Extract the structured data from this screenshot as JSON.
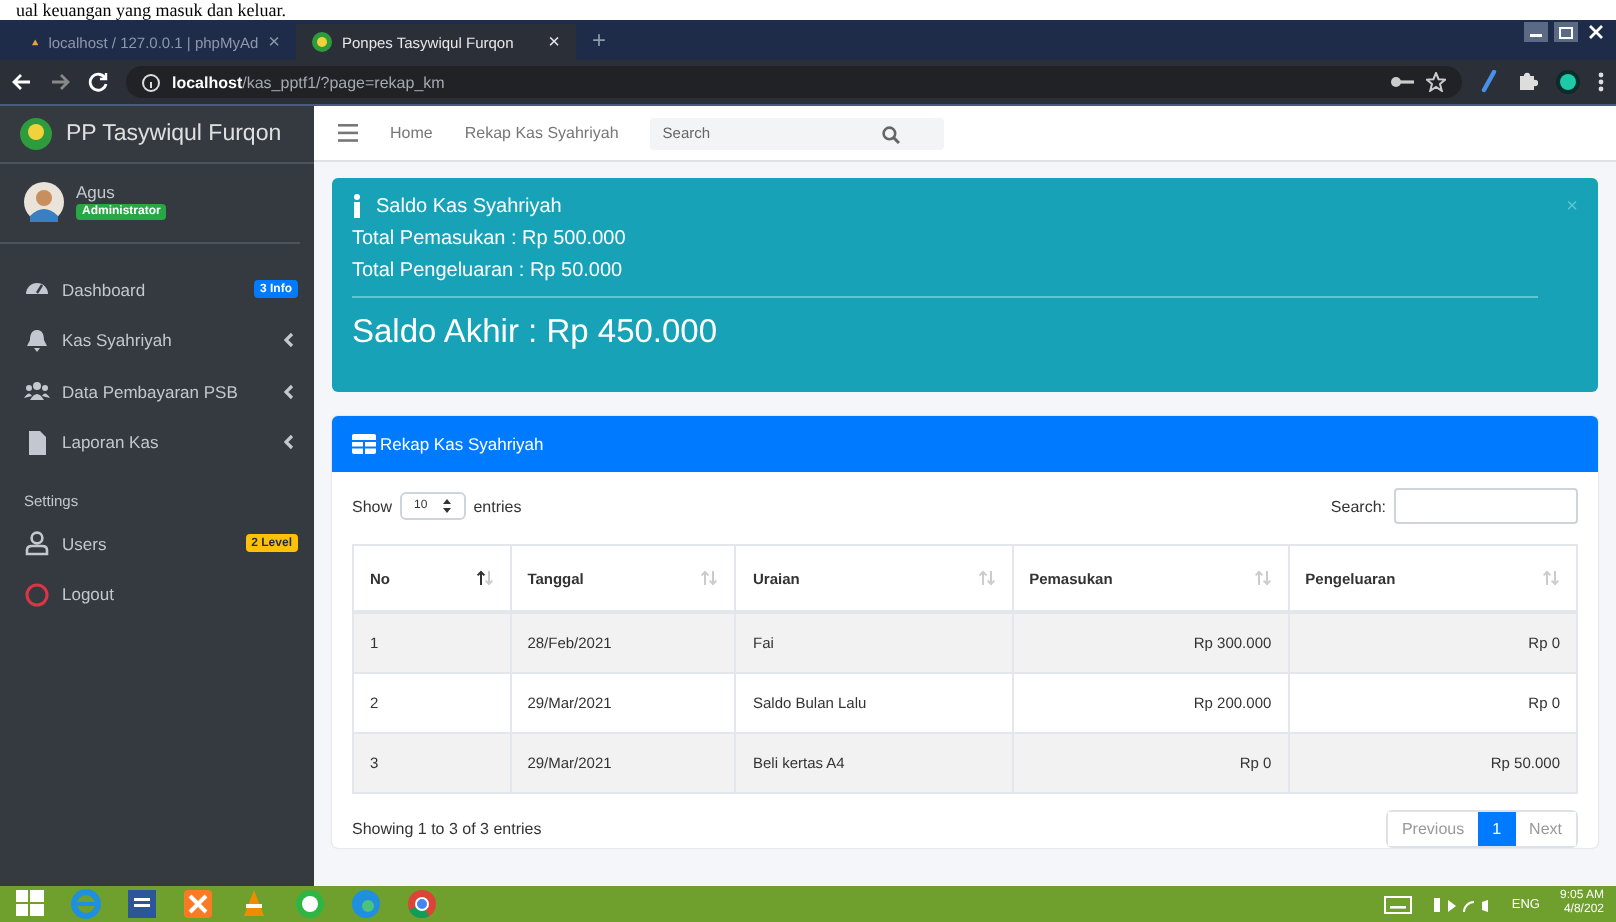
{
  "document_caption": "ual keuangan yang masuk dan keluar.",
  "browser": {
    "tabs": [
      {
        "title": "localhost / 127.0.0.1 | phpMyAd",
        "selected": false,
        "close": "×"
      },
      {
        "title": "Ponpes Tasywiqul Furqon",
        "selected": true,
        "close": "×"
      }
    ],
    "new_tab": "+",
    "url_host": "localhost",
    "url_path": "/kas_pptf1/?page=rekap_km"
  },
  "brand": "PP Tasywiqul Furqon",
  "topnav": {
    "links": [
      "Home",
      "Rekap Kas Syahriyah"
    ],
    "search_placeholder": "Search"
  },
  "user": {
    "name": "Agus",
    "role": "Administrator"
  },
  "sidebar": {
    "items": [
      {
        "label": "Dashboard",
        "kind": "dashboard",
        "badge": "3 Info",
        "color": "#007bff",
        "submenu": false
      },
      {
        "label": "Kas Syahriyah",
        "kind": "bell",
        "submenu": true
      },
      {
        "label": "Data Pembayaran PSB",
        "kind": "users",
        "submenu": true
      },
      {
        "label": "Laporan Kas",
        "kind": "file",
        "submenu": true
      }
    ],
    "settings_header": "Settings",
    "settings_items": [
      {
        "label": "Users",
        "kind": "user",
        "badge": "2 Level",
        "color": "#ffc107"
      },
      {
        "label": "Logout",
        "kind": "logout"
      }
    ]
  },
  "info_box": {
    "title": "Saldo Kas Syahriyah",
    "lines": [
      "Total Pemasukan : Rp 500.000",
      "Total Pengeluaran : Rp 50.000"
    ],
    "balance": "Saldo Akhir : Rp 450.000",
    "close": "×"
  },
  "card": {
    "title": "Rekap Kas Syahriyah",
    "show_label": "Show",
    "page_size": "10",
    "entries_label": "entries",
    "search_label": "Search:",
    "columns": [
      {
        "label": "No",
        "sorted": true
      },
      {
        "label": "Tanggal",
        "sorted": false
      },
      {
        "label": "Uraian",
        "sorted": false
      },
      {
        "label": "Pemasukan",
        "sorted": false
      },
      {
        "label": "Pengeluaran",
        "sorted": false
      }
    ],
    "rows": [
      [
        "1",
        "28/Feb/2021",
        "Fai",
        "Rp 300.000",
        "Rp 0"
      ],
      [
        "2",
        "29/Mar/2021",
        "Saldo Bulan Lalu",
        "Rp 200.000",
        "Rp 0"
      ],
      [
        "3",
        "29/Mar/2021",
        "Beli kertas A4",
        "Rp 0",
        "Rp 50.000"
      ]
    ],
    "info": "Showing 1 to 3 of 3 entries",
    "pagination": [
      {
        "label": "Previous",
        "selected": false
      },
      {
        "label": "1",
        "selected": true
      },
      {
        "label": "Next",
        "selected": false
      }
    ]
  },
  "taskbar": {
    "apps": [
      {
        "kind": "start"
      },
      {
        "kind": "ie"
      },
      {
        "kind": "word"
      },
      {
        "kind": "xampp"
      },
      {
        "kind": "vlc"
      },
      {
        "kind": "whatsapp"
      },
      {
        "kind": "edge"
      },
      {
        "kind": "chrome"
      }
    ],
    "lang": "ENG",
    "time": "9:05 AM",
    "date": "4/8/202"
  }
}
